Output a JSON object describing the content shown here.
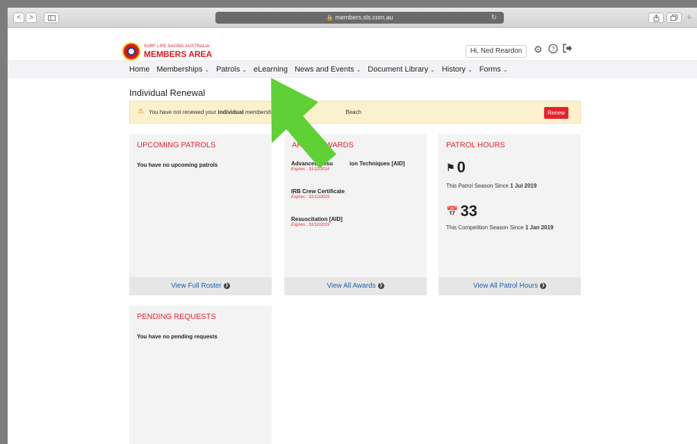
{
  "browser": {
    "url": "members.sls.com.au",
    "back_glyph": "<",
    "forward_glyph": ">",
    "plus_glyph": "+"
  },
  "header": {
    "logo_small": "SURF LIFE SAVING AUSTRALIA",
    "logo_big": "MEMBERS AREA",
    "greeting": "Hi, Ned Reardon"
  },
  "nav": {
    "items": [
      {
        "label": "Home"
      },
      {
        "label": "Memberships"
      },
      {
        "label": "Patrols"
      },
      {
        "label": "eLearning"
      },
      {
        "label": "News and Events"
      },
      {
        "label": "Document Library"
      },
      {
        "label": "History"
      },
      {
        "label": "Forms"
      }
    ]
  },
  "renewal": {
    "title": "Individual Renewal",
    "msg_prefix": "You have not renewed your",
    "msg_bold": "individual",
    "msg_suffix": "membership f",
    "msg_tail": "Beach",
    "button": "Renew"
  },
  "patrols": {
    "title": "UPCOMING PATROLS",
    "empty": "You have no upcoming patrols",
    "footer": "View Full Roster"
  },
  "awards": {
    "title_left": "",
    "title_partial": "ARIN",
    "title_right": "WARDS",
    "items": [
      {
        "name_a": "Advanced Resu",
        "name_b": "ion Techniques [AID]",
        "expires": "Expires : 31/12/2019"
      },
      {
        "name_a": "IRB Crew Certificate",
        "name_b": "",
        "expires": "Expires : 31/12/2019"
      },
      {
        "name_a": "Resuscitation [AID]",
        "name_b": "",
        "expires": "Expires : 31/12/2019"
      }
    ],
    "footer": "View All Awards"
  },
  "hours": {
    "title": "PATROL HOURS",
    "patrol_value": "0",
    "patrol_label": "This Patrol Season Since",
    "patrol_since": "1 Jul 2019",
    "comp_value": "33",
    "comp_label": "This Competition Season Since",
    "comp_since": "1 Jan 2019",
    "footer": "View All Patrol Hours"
  },
  "pending": {
    "title": "PENDING REQUESTS",
    "empty": "You have no pending requests"
  },
  "colors": {
    "accent_red": "#e4222e",
    "arrow_green": "#5fd135",
    "link_blue": "#1e5fa8",
    "alert_bg": "#fbf1cc"
  }
}
